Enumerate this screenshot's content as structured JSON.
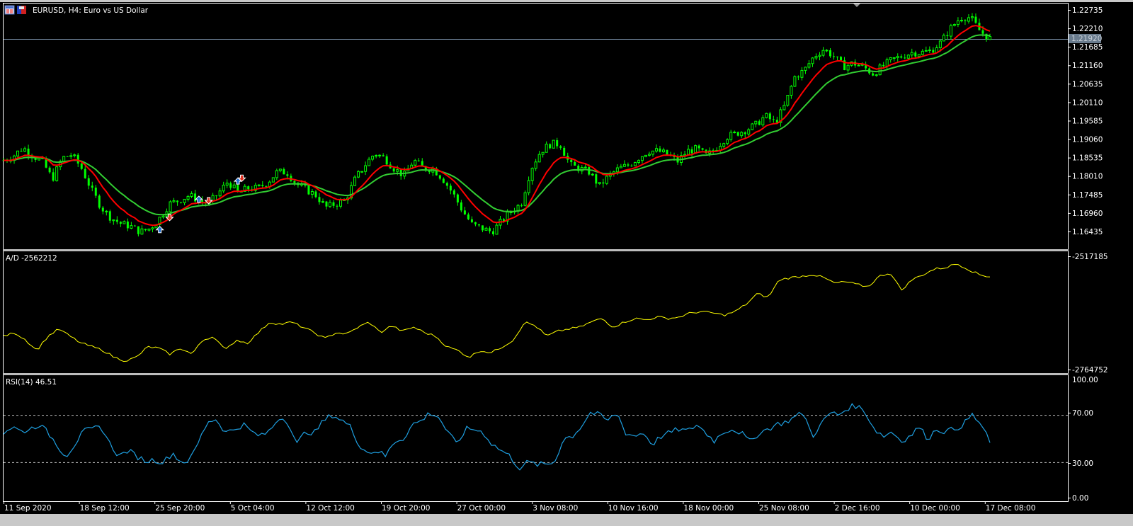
{
  "window": {
    "title": "EURUSD, H4:  Euro vs US Dollar",
    "current_price_label": "1.21920"
  },
  "colors": {
    "bars": "#00ff00",
    "ma_fast": "#ff0000",
    "ma_slow": "#32cd32",
    "ad_line": "#ffff00",
    "rsi_line": "#1e9fe0",
    "buy_arrow": "#1e6fd0",
    "sell_arrow": "#e03020",
    "grid": "#c0c0c0"
  },
  "price_axis": [
    "1.22735",
    "1.22210",
    "1.21685",
    "1.21160",
    "1.20635",
    "1.20110",
    "1.19585",
    "1.19060",
    "1.18535",
    "1.18010",
    "1.17485",
    "1.16960",
    "1.16435"
  ],
  "ad_pane": {
    "label": "A/D -2562212",
    "max_label": "-2517185",
    "min_label": "-2764752"
  },
  "rsi_pane": {
    "label": "RSI(14) 46.51",
    "levels": [
      "100.00",
      "70.00",
      "30.00",
      "0.00"
    ]
  },
  "time_axis": [
    "11 Sep 2020",
    "18 Sep 12:00",
    "25 Sep 20:00",
    "5 Oct 04:00",
    "12 Oct 12:00",
    "19 Oct 20:00",
    "27 Oct 00:00",
    "3 Nov 08:00",
    "10 Nov 16:00",
    "18 Nov 00:00",
    "25 Nov 08:00",
    "2 Dec 16:00",
    "10 Dec 00:00",
    "17 Dec 08:00"
  ],
  "chart_data": [
    {
      "type": "candlestick",
      "title": "EURUSD, H4",
      "ylim": [
        1.16435,
        1.22735
      ],
      "close": [
        1.1846,
        1.1858,
        1.1882,
        1.1858,
        1.1842,
        1.1792,
        1.1852,
        1.1862,
        1.1822,
        1.1762,
        1.1712,
        1.1682,
        1.1666,
        1.1658,
        1.1642,
        1.1652,
        1.1682,
        1.1722,
        1.1732,
        1.1746,
        1.1732,
        1.1722,
        1.1752,
        1.1786,
        1.1752,
        1.1766,
        1.1766,
        1.1782,
        1.1812,
        1.1812,
        1.1778,
        1.1762,
        1.1746,
        1.1712,
        1.1722,
        1.1732,
        1.1792,
        1.1832,
        1.1866,
        1.1852,
        1.1822,
        1.1802,
        1.1846,
        1.1822,
        1.1822,
        1.1792,
        1.1752,
        1.1702,
        1.1662,
        1.1652,
        1.1642,
        1.1672,
        1.1702,
        1.1722,
        1.1822,
        1.1872,
        1.1892,
        1.1892,
        1.1832,
        1.1822,
        1.1812,
        1.1772,
        1.1802,
        1.1822,
        1.1832,
        1.1852,
        1.1872,
        1.1872,
        1.1862,
        1.1842,
        1.1872,
        1.1878,
        1.1858,
        1.1882,
        1.1912,
        1.1922,
        1.1932,
        1.1946,
        1.1972,
        1.1952,
        1.2002,
        1.2082,
        1.2102,
        1.2142,
        1.2162,
        1.2142,
        1.2112,
        1.2122,
        1.2112,
        1.2092,
        1.2112,
        1.2132,
        1.2142,
        1.2152,
        1.2152,
        1.2158,
        1.2182,
        1.2222,
        1.2252,
        1.2252,
        1.2212,
        1.2192
      ],
      "signals": [
        {
          "dir": "buy",
          "bar": 16,
          "price": 1.1648
        },
        {
          "dir": "sell",
          "bar": 17,
          "price": 1.1684
        },
        {
          "dir": "buy",
          "bar": 20,
          "price": 1.1734
        },
        {
          "dir": "sell",
          "bar": 21,
          "price": 1.1732
        },
        {
          "dir": "buy",
          "bar": 24,
          "price": 1.1786
        },
        {
          "dir": "sell",
          "bar": 24.4,
          "price": 1.1796
        }
      ]
    },
    {
      "type": "line",
      "title": "A/D",
      "ylim": [
        -2764752,
        -2517185
      ],
      "values": [
        -2692000,
        -2684000,
        -2700000,
        -2723000,
        -2692000,
        -2676000,
        -2692000,
        -2707000,
        -2715000,
        -2723000,
        -2738000,
        -2746000,
        -2738000,
        -2715000,
        -2718000,
        -2731000,
        -2718000,
        -2731000,
        -2700000,
        -2692000,
        -2723000,
        -2700000,
        -2707000,
        -2684000,
        -2661000,
        -2666000,
        -2661000,
        -2672000,
        -2684000,
        -2697000,
        -2684000,
        -2687000,
        -2672000,
        -2661000,
        -2684000,
        -2669000,
        -2681000,
        -2672000,
        -2684000,
        -2692000,
        -2715000,
        -2723000,
        -2738000,
        -2723000,
        -2728000,
        -2715000,
        -2700000,
        -2661000,
        -2669000,
        -2692000,
        -2681000,
        -2676000,
        -2672000,
        -2661000,
        -2653000,
        -2672000,
        -2661000,
        -2653000,
        -2656000,
        -2650000,
        -2653000,
        -2650000,
        -2641000,
        -2638000,
        -2641000,
        -2646000,
        -2638000,
        -2622000,
        -2599000,
        -2607000,
        -2568000,
        -2564000,
        -2561000,
        -2557000,
        -2564000,
        -2576000,
        -2573000,
        -2579000,
        -2584000,
        -2561000,
        -2553000,
        -2591000,
        -2568000,
        -2557000,
        -2545000,
        -2542000,
        -2533000,
        -2545000,
        -2557000,
        -2562212
      ]
    },
    {
      "type": "line",
      "title": "RSI(14)",
      "ylim": [
        0,
        100
      ],
      "levels": [
        70,
        30
      ],
      "values": [
        55,
        60,
        56,
        58,
        62,
        55,
        45,
        35,
        45,
        56,
        58,
        60,
        45,
        35,
        40,
        35,
        31,
        32,
        30,
        38,
        30,
        32,
        48,
        65,
        66,
        55,
        58,
        62,
        55,
        52,
        57,
        68,
        65,
        45,
        56,
        55,
        65,
        70,
        66,
        60,
        45,
        38,
        40,
        35,
        48,
        50,
        62,
        65,
        72,
        68,
        55,
        45,
        58,
        58,
        55,
        45,
        40,
        35,
        25,
        30,
        28,
        28,
        30,
        50,
        52,
        60,
        72,
        70,
        65,
        72,
        55,
        52,
        55,
        45,
        52,
        55,
        58,
        56,
        62,
        55,
        48,
        56,
        58,
        55,
        47,
        55,
        58,
        62,
        64,
        68,
        72,
        52,
        62,
        72,
        70,
        76,
        78,
        72,
        58,
        52,
        56,
        48,
        52,
        60,
        50,
        58,
        56,
        58,
        62,
        70,
        62,
        46.51
      ]
    }
  ]
}
